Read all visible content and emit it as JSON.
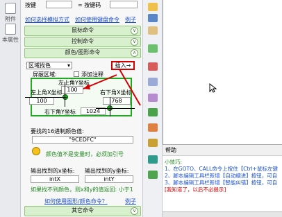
{
  "rail": {
    "items": [
      {
        "label": "附件"
      },
      {
        "label": "本属性"
      }
    ]
  },
  "top": {
    "key_label": "按键",
    "key_code_label": "= 按键码",
    "link_simulate": "如何选择模拟方式",
    "link_keyboard": "如何使用键盘命令",
    "example": "例子"
  },
  "sections": {
    "mouse": "鼠标命令",
    "control": "控制命令",
    "color": "颜色/图形命令",
    "other": "其它命令"
  },
  "color_panel": {
    "mode_select": "区域找色",
    "mask_label": "屏蔽区域:",
    "add_comment_label": "添加注释",
    "insert_button": "插入→",
    "top_left_y_label": "左上角Y坐标",
    "top_left_y_value": "100",
    "top_left_x_label": "左上角X坐标",
    "top_left_x_value": "100",
    "bottom_right_x_label": "右下角X坐标",
    "bottom_right_x_value": "768",
    "bottom_right_y_label": "右下角Y坐标",
    "bottom_right_y_value": "1024",
    "hex_color_label": "要找的16进制颜色值:",
    "hex_color_value": "\"9CEDFC\"",
    "hint_text": "颜色值不是变量时，必须加引号",
    "output_x_label": "输出找到的x坐标:",
    "output_x_value": "intX",
    "output_y_label": "输出找到的y坐标:",
    "output_y_value": "intY",
    "note_text": "如果找不到颜色，则x和y的值返回: 小于1",
    "link_how_use": "如何使用图形/颜色命令？",
    "example": "例子"
  },
  "help": {
    "tab_label": "帮助",
    "title": "小技巧:",
    "lines": [
      "1、在GOTO、CALL命令上按住【Ctrl+鼠标左键",
      "2、脚本编辑工具栏新增【自动缩进】按钮，可自",
      "3、脚本编辑工具栏新增【智能纠错】按钮，可自"
    ],
    "dismiss": "[我知道了，以后不必提示]"
  },
  "colors": {
    "accent": "#1a4fd0",
    "section_bg": "#d9f0cf",
    "box_border": "#22aa22",
    "red": "#d40000"
  }
}
